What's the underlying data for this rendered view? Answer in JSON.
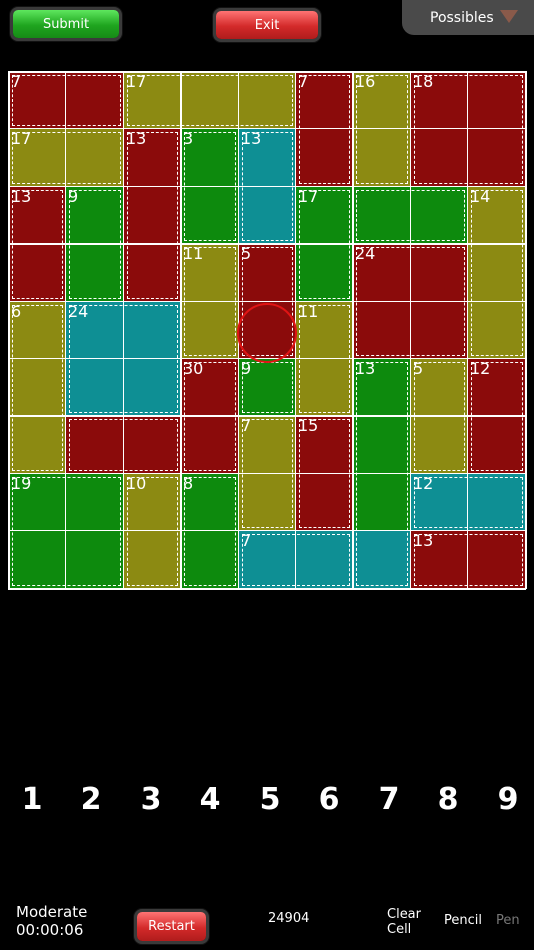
{
  "toolbar": {
    "submit_label": "Submit",
    "exit_label": "Exit",
    "possibles_label": "Possibles"
  },
  "colors": {
    "red": "#8b0b0b",
    "olive": "#8c8a12",
    "green": "#0d8a0d",
    "teal": "#0e8f94",
    "selection": "#e01414"
  },
  "board": {
    "rows": [
      [
        "red",
        "red",
        "olive",
        "olive",
        "olive",
        "red",
        "olive",
        "red",
        "red"
      ],
      [
        "olive",
        "olive",
        "red",
        "green",
        "teal",
        "red",
        "olive",
        "red",
        "red"
      ],
      [
        "red",
        "green",
        "red",
        "green",
        "teal",
        "green",
        "green",
        "green",
        "olive"
      ],
      [
        "red",
        "green",
        "red",
        "olive",
        "red",
        "green",
        "red",
        "red",
        "olive"
      ],
      [
        "olive",
        "teal",
        "teal",
        "olive",
        "red",
        "olive",
        "red",
        "red",
        "olive"
      ],
      [
        "olive",
        "teal",
        "teal",
        "red",
        "green",
        "olive",
        "green",
        "olive",
        "red"
      ],
      [
        "olive",
        "red",
        "red",
        "red",
        "olive",
        "red",
        "green",
        "olive",
        "red"
      ],
      [
        "green",
        "green",
        "olive",
        "green",
        "olive",
        "red",
        "green",
        "teal",
        "teal"
      ],
      [
        "green",
        "green",
        "olive",
        "green",
        "teal",
        "teal",
        "teal",
        "red",
        "red"
      ]
    ],
    "sums": [
      {
        "row": 0,
        "col": 0,
        "text": "7"
      },
      {
        "row": 0,
        "col": 2,
        "text": "17"
      },
      {
        "row": 0,
        "col": 5,
        "text": "7"
      },
      {
        "row": 0,
        "col": 6,
        "text": "16"
      },
      {
        "row": 0,
        "col": 7,
        "text": "18"
      },
      {
        "row": 1,
        "col": 0,
        "text": "17"
      },
      {
        "row": 1,
        "col": 2,
        "text": "13"
      },
      {
        "row": 1,
        "col": 3,
        "text": "3"
      },
      {
        "row": 1,
        "col": 4,
        "text": "13"
      },
      {
        "row": 2,
        "col": 0,
        "text": "13"
      },
      {
        "row": 2,
        "col": 1,
        "text": "9"
      },
      {
        "row": 2,
        "col": 5,
        "text": "17"
      },
      {
        "row": 2,
        "col": 8,
        "text": "14"
      },
      {
        "row": 3,
        "col": 3,
        "text": "11"
      },
      {
        "row": 3,
        "col": 4,
        "text": "5"
      },
      {
        "row": 3,
        "col": 6,
        "text": "24"
      },
      {
        "row": 4,
        "col": 0,
        "text": "6"
      },
      {
        "row": 4,
        "col": 1,
        "text": "24"
      },
      {
        "row": 4,
        "col": 5,
        "text": "11"
      },
      {
        "row": 5,
        "col": 3,
        "text": "30"
      },
      {
        "row": 5,
        "col": 4,
        "text": "9"
      },
      {
        "row": 5,
        "col": 6,
        "text": "13"
      },
      {
        "row": 5,
        "col": 7,
        "text": "5"
      },
      {
        "row": 5,
        "col": 8,
        "text": "12"
      },
      {
        "row": 6,
        "col": 4,
        "text": "7"
      },
      {
        "row": 6,
        "col": 5,
        "text": "15"
      },
      {
        "row": 7,
        "col": 0,
        "text": "19"
      },
      {
        "row": 7,
        "col": 2,
        "text": "10"
      },
      {
        "row": 7,
        "col": 3,
        "text": "8"
      },
      {
        "row": 7,
        "col": 7,
        "text": "12"
      },
      {
        "row": 8,
        "col": 4,
        "text": "7"
      },
      {
        "row": 8,
        "col": 7,
        "text": "13"
      }
    ],
    "cages": [
      {
        "r0": 0,
        "c0": 0,
        "r1": 0,
        "c1": 1
      },
      {
        "r0": 0,
        "c0": 2,
        "r1": 0,
        "c1": 4
      },
      {
        "r0": 0,
        "c0": 5,
        "r1": 1,
        "c1": 5
      },
      {
        "r0": 0,
        "c0": 6,
        "r1": 1,
        "c1": 6
      },
      {
        "r0": 0,
        "c0": 7,
        "r1": 1,
        "c1": 8
      },
      {
        "r0": 1,
        "c0": 0,
        "r1": 1,
        "c1": 1
      },
      {
        "r0": 1,
        "c0": 2,
        "r1": 3,
        "c1": 2
      },
      {
        "r0": 1,
        "c0": 3,
        "r1": 2,
        "c1": 3
      },
      {
        "r0": 1,
        "c0": 4,
        "r1": 2,
        "c1": 4
      },
      {
        "r0": 2,
        "c0": 0,
        "r1": 3,
        "c1": 0
      },
      {
        "r0": 2,
        "c0": 1,
        "r1": 3,
        "c1": 1
      },
      {
        "r0": 2,
        "c0": 5,
        "r1": 3,
        "c1": 5
      },
      {
        "r0": 2,
        "c0": 6,
        "r1": 2,
        "c1": 7
      },
      {
        "r0": 2,
        "c0": 8,
        "r1": 4,
        "c1": 8
      },
      {
        "r0": 3,
        "c0": 3,
        "r1": 4,
        "c1": 3
      },
      {
        "r0": 3,
        "c0": 4,
        "r1": 4,
        "c1": 4
      },
      {
        "r0": 3,
        "c0": 6,
        "r1": 4,
        "c1": 7
      },
      {
        "r0": 4,
        "c0": 0,
        "r1": 6,
        "c1": 0
      },
      {
        "r0": 4,
        "c0": 1,
        "r1": 5,
        "c1": 2
      },
      {
        "r0": 4,
        "c0": 5,
        "r1": 5,
        "c1": 5
      },
      {
        "r0": 5,
        "c0": 3,
        "r1": 6,
        "c1": 3
      },
      {
        "r0": 6,
        "c0": 1,
        "r1": 6,
        "c1": 2
      },
      {
        "r0": 5,
        "c0": 4,
        "r1": 5,
        "c1": 4
      },
      {
        "r0": 5,
        "c0": 6,
        "r1": 8,
        "c1": 6
      },
      {
        "r0": 5,
        "c0": 7,
        "r1": 6,
        "c1": 7
      },
      {
        "r0": 5,
        "c0": 8,
        "r1": 6,
        "c1": 8
      },
      {
        "r0": 6,
        "c0": 4,
        "r1": 7,
        "c1": 4
      },
      {
        "r0": 6,
        "c0": 5,
        "r1": 7,
        "c1": 5
      },
      {
        "r0": 7,
        "c0": 0,
        "r1": 8,
        "c1": 1
      },
      {
        "r0": 7,
        "c0": 2,
        "r1": 8,
        "c1": 2
      },
      {
        "r0": 7,
        "c0": 3,
        "r1": 8,
        "c1": 3
      },
      {
        "r0": 7,
        "c0": 7,
        "r1": 7,
        "c1": 8
      },
      {
        "r0": 8,
        "c0": 4,
        "r1": 8,
        "c1": 5
      },
      {
        "r0": 8,
        "c0": 7,
        "r1": 8,
        "c1": 8
      }
    ],
    "selected": {
      "row": 4,
      "col": 4
    }
  },
  "numpad": [
    "1",
    "2",
    "3",
    "4",
    "5",
    "6",
    "7",
    "8",
    "9"
  ],
  "footer": {
    "difficulty": "Moderate",
    "timer": "00:00:06",
    "restart_label": "Restart",
    "puzzle_id": "24904",
    "clear_cell_line1": "Clear",
    "clear_cell_line2": "Cell",
    "pencil_label": "Pencil",
    "pen_label": "Pen"
  }
}
